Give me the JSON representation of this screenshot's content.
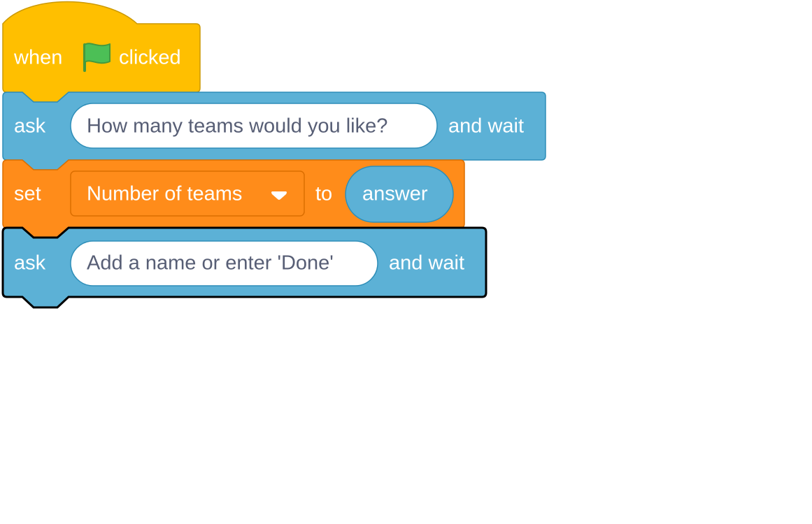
{
  "colors": {
    "events": "#ffbf00",
    "events_border": "#cc9900",
    "sensing": "#5cb1d6",
    "sensing_border": "#2e8eb8",
    "variables": "#ff8c1a",
    "variables_border": "#db6e00",
    "text_field": "#ffffff",
    "text_field_text": "#575e75",
    "flag": "#4cbf56",
    "flag_border": "#45993d",
    "selected_outline": "#000000"
  },
  "blocks": {
    "hat": {
      "word_when": "when",
      "icon": "green-flag-icon",
      "word_clicked": "clicked"
    },
    "ask1": {
      "word_ask": "ask",
      "question": "How many teams would you like?",
      "word_and_wait": "and wait"
    },
    "set": {
      "word_set": "set",
      "variable": "Number of teams",
      "dropdown_icon": "caret-down-icon",
      "word_to": "to",
      "reporter": "answer"
    },
    "ask2": {
      "word_ask": "ask",
      "question": "Add a name or enter 'Done'",
      "word_and_wait": "and wait",
      "selected": true
    }
  }
}
